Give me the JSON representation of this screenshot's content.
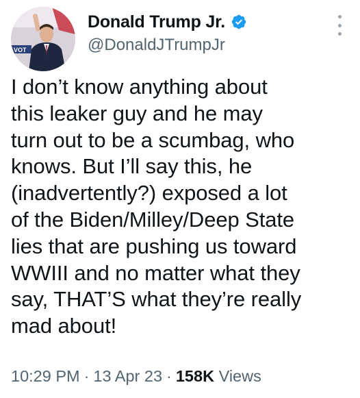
{
  "user": {
    "display_name": "Donald Trump Jr.",
    "handle": "@DonaldJTrumpJr",
    "verified": true,
    "avatar_icon": "profile-photo"
  },
  "tweet": {
    "lines": [
      "I don’t know anything about",
      "this leaker guy and he may",
      "turn out to be a scumbag, who",
      "knows. But I’ll say this, he",
      "(inadvertently?) exposed a lot",
      "of the Biden/Milley/Deep State",
      "lies that are pushing us toward",
      "WWIII and no matter what they",
      "say, THAT’S what they’re really",
      "mad about!"
    ],
    "time": "10:29 PM",
    "date": "13 Apr 23",
    "views_count": "158K",
    "views_label": "Views"
  },
  "icons": {
    "verified": "verified-badge-icon",
    "more": "more-options-icon"
  },
  "colors": {
    "verified_blue": "#1d9bf0",
    "text": "#0f1419",
    "secondary": "#536471"
  }
}
